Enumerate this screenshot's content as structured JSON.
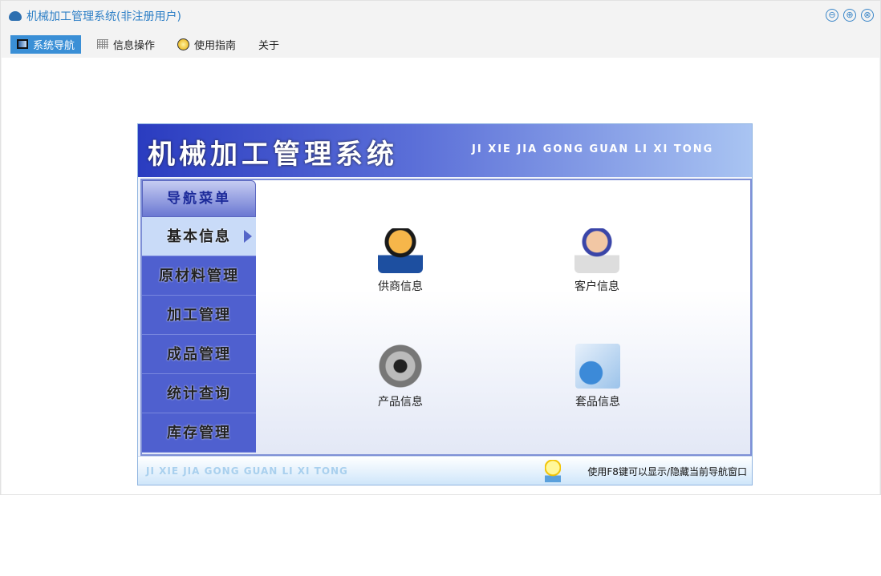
{
  "window": {
    "title": "机械加工管理系统(非注册用户)",
    "buttons": [
      "⊖",
      "⊕",
      "⊗"
    ]
  },
  "menubar": [
    {
      "label": "系统导航",
      "icon": "monitor-icon",
      "active": true
    },
    {
      "label": "信息操作",
      "icon": "grid-icon"
    },
    {
      "label": "使用指南",
      "icon": "help-icon"
    },
    {
      "label": "关于"
    }
  ],
  "app": {
    "title": "机械加工管理系统",
    "pinyin": "JI XIE JIA GONG GUAN LI XI TONG",
    "nav_header": "导航菜单",
    "nav": [
      "基本信息",
      "原材料管理",
      "加工管理",
      "成品管理",
      "统计查询",
      "库存管理"
    ],
    "tiles": [
      "供商信息",
      "客户信息",
      "产品信息",
      "套品信息"
    ],
    "footer_pinyin": "JI XIE JIA GONG GUAN LI XI TONG",
    "footer_tip": "使用F8键可以显示/隐藏当前导航窗口"
  }
}
